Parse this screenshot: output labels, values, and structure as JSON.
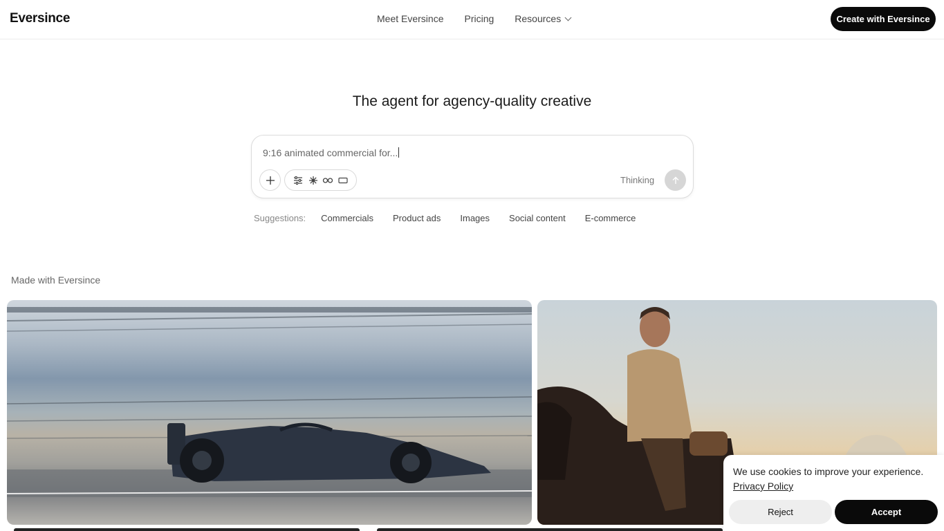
{
  "header": {
    "logo": "Eversince",
    "nav": [
      {
        "label": "Meet Eversince"
      },
      {
        "label": "Pricing"
      },
      {
        "label": "Resources"
      }
    ],
    "cta_label": "Create with Eversince"
  },
  "hero": {
    "headline": "The agent for agency-quality creative",
    "prompt_text": "9:16 animated commercial for...",
    "thinking_label": "Thinking",
    "tool_icons": [
      "sliders-icon",
      "sparkle-icon",
      "infinity-icon",
      "aspect-ratio-icon"
    ]
  },
  "suggestions": {
    "label": "Suggestions:",
    "items": [
      "Commercials",
      "Product ads",
      "Images",
      "Social content",
      "E-commerce"
    ]
  },
  "gallery": {
    "heading": "Made with Eversince"
  },
  "cookie": {
    "message": "We use cookies to improve your experience.",
    "policy_link": "Privacy Policy",
    "reject_label": "Reject",
    "accept_label": "Accept"
  },
  "colors": {
    "primary": "#0a0a0a",
    "send_disabled": "#d6d6d6",
    "border": "#dcdcdc"
  }
}
